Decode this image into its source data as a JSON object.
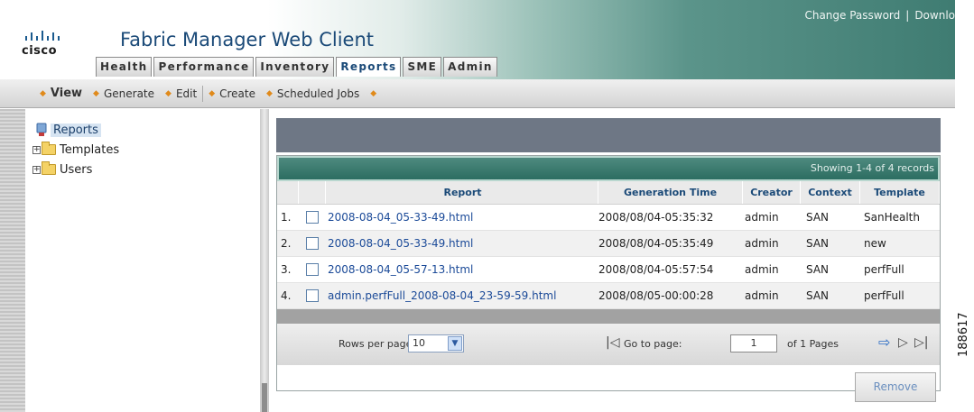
{
  "header": {
    "brand": "cisco",
    "app_title": "Fabric Manager Web Client",
    "util_links": [
      "Change Password",
      "Downlo"
    ],
    "tabs": [
      {
        "label": "Health",
        "active": false
      },
      {
        "label": "Performance",
        "active": false
      },
      {
        "label": "Inventory",
        "active": false
      },
      {
        "label": "Reports",
        "active": true
      },
      {
        "label": "SME",
        "active": false
      },
      {
        "label": "Admin",
        "active": false
      }
    ],
    "accent_color": "#3f7c72"
  },
  "menu": {
    "items": [
      "View",
      "Generate",
      "Edit",
      "Create",
      "Scheduled Jobs"
    ]
  },
  "tree": {
    "root": "Reports",
    "children": [
      "Templates",
      "Users"
    ]
  },
  "table": {
    "showing": "Showing 1-4 of 4 records",
    "columns": [
      "Report",
      "Generation Time",
      "Creator",
      "Context",
      "Template"
    ],
    "rows": [
      {
        "num": "1.",
        "report": "2008-08-04_05-33-49.html",
        "generation_time": "2008/08/04-05:35:32",
        "creator": "admin",
        "context": "SAN",
        "template": "SanHealth"
      },
      {
        "num": "2.",
        "report": "2008-08-04_05-33-49.html",
        "generation_time": "2008/08/04-05:35:49",
        "creator": "admin",
        "context": "SAN",
        "template": "new"
      },
      {
        "num": "3.",
        "report": "2008-08-04_05-57-13.html",
        "generation_time": "2008/08/04-05:57:54",
        "creator": "admin",
        "context": "SAN",
        "template": "perfFull"
      },
      {
        "num": "4.",
        "report": "admin.perfFull_2008-08-04_23-59-59.html",
        "generation_time": "2008/08/05-00:00:28",
        "creator": "admin",
        "context": "SAN",
        "template": "perfFull"
      }
    ]
  },
  "pager": {
    "rows_label": "Rows per page:",
    "rows_value": "10",
    "goto_label": "Go to page:",
    "page_value": "1",
    "of_pages": "of 1 Pages"
  },
  "buttons": {
    "remove": "Remove"
  },
  "figure_id": "188617"
}
